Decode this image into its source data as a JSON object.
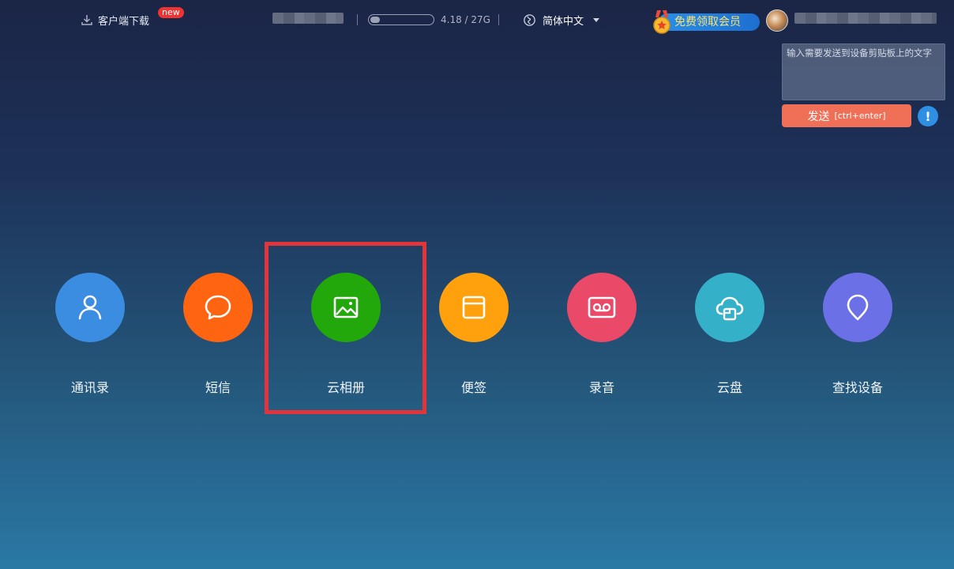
{
  "topbar": {
    "download_label": "客户端下载",
    "new_badge": "new",
    "storage": {
      "text": "4.18 / 27G",
      "used_fraction": 0.155
    },
    "language": "简体中文",
    "vip_label": "免费领取会员"
  },
  "clipboard": {
    "placeholder": "输入需要发送到设备剪贴板上的文字",
    "send_label": "发送",
    "send_hint": "[ctrl+enter]",
    "info_symbol": "!"
  },
  "apps": [
    {
      "label": "通讯录",
      "color": "#3a8de0",
      "icon": "contacts-icon"
    },
    {
      "label": "短信",
      "color": "#ff6410",
      "icon": "message-icon"
    },
    {
      "label": "云相册",
      "color": "#23a80c",
      "icon": "photo-icon"
    },
    {
      "label": "便签",
      "color": "#ffa10c",
      "icon": "notes-icon"
    },
    {
      "label": "录音",
      "color": "#ea4a68",
      "icon": "recorder-icon"
    },
    {
      "label": "云盘",
      "color": "#35b0c9",
      "icon": "cloud-drive-icon"
    },
    {
      "label": "查找设备",
      "color": "#6b70e6",
      "icon": "location-icon"
    }
  ],
  "highlight_color": "#e2343b"
}
